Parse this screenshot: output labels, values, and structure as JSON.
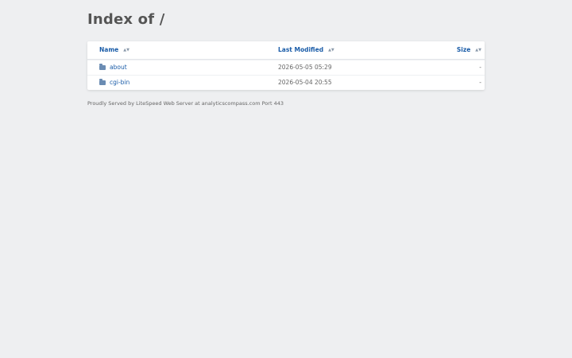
{
  "page": {
    "title": "Index of /"
  },
  "listing": {
    "headers": {
      "name": "Name",
      "last_modified": "Last Modified",
      "size": "Size"
    },
    "sort_indicators": {
      "name": "▲▼",
      "last_modified": "▲▼",
      "size": "▲▼"
    },
    "rows": [
      {
        "name": "about",
        "modified": "2026-05-05 05:29",
        "size": "-",
        "icon": "folder-icon"
      },
      {
        "name": "cgi-bin",
        "modified": "2026-05-04 20:55",
        "size": "-",
        "icon": "folder-icon"
      }
    ]
  },
  "footer": {
    "text": "Proudly Served by LiteSpeed Web Server at analyticscompass.com Port 443"
  },
  "colors": {
    "background": "#eeeff1",
    "link": "#1a5ca8",
    "folder": "#6b8cb3"
  }
}
